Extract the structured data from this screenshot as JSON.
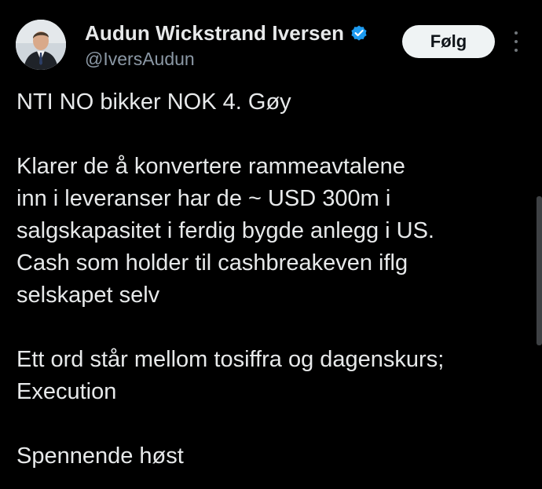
{
  "author": {
    "display_name": "Audun Wickstrand Iversen",
    "handle": "@IversAudun",
    "verified": true,
    "avatar_icon": "profile-photo"
  },
  "actions": {
    "follow_label": "Følg",
    "more_icon": "more-options-icon"
  },
  "tweet": {
    "paragraphs": [
      [
        "NTI NO bikker NOK 4. Gøy"
      ],
      [
        "Klarer de å konvertere rammeavtalene",
        "inn i leveranser har de ~ USD 300m i",
        "salgskapasitet i ferdig bygde anlegg i US.",
        "Cash som holder til cashbreakeven iflg",
        "selskapet selv"
      ],
      [
        "Ett ord står mellom tosiffra og dagenskurs;",
        "Execution"
      ],
      [
        "Spennende høst"
      ]
    ]
  },
  "colors": {
    "background": "#000000",
    "text": "#e7e9ea",
    "secondary_text": "#8b98a5",
    "verified_blue": "#1d9bf0",
    "follow_bg": "#eff3f4"
  }
}
